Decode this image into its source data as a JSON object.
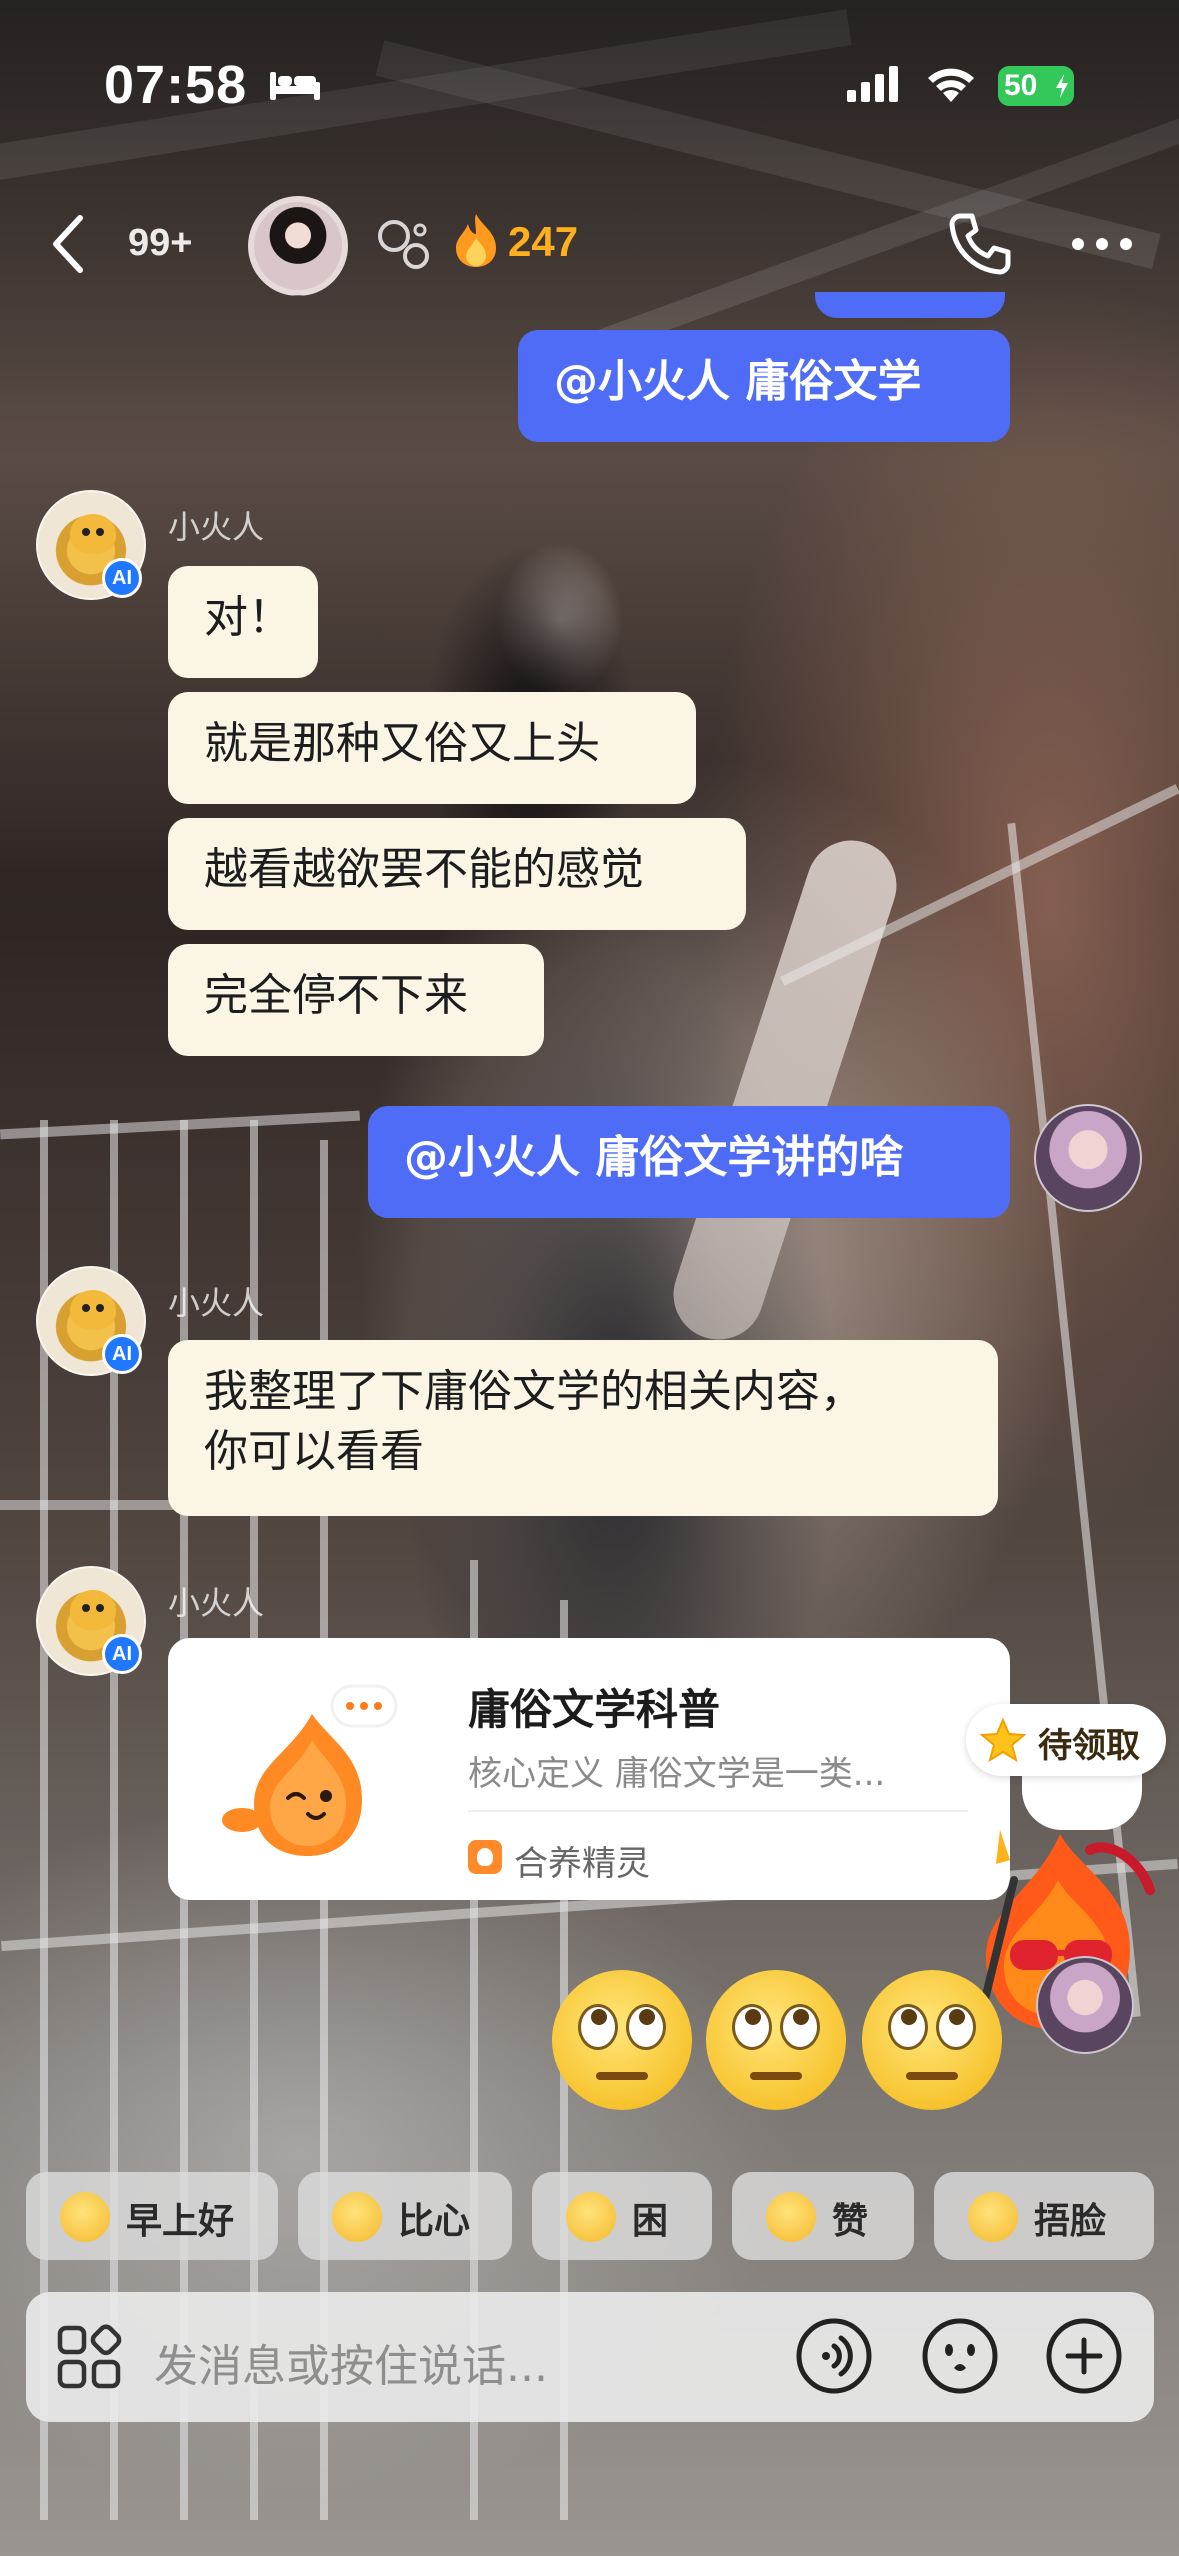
{
  "status_bar": {
    "time": "07:58",
    "battery": "50"
  },
  "header": {
    "unread_count": "99+",
    "streak": "247"
  },
  "messages": {
    "m1": "@小火人 庸俗文学",
    "ai_name": "小火人",
    "m2": "对！",
    "m3": "就是那种又俗又上头",
    "m4": "越看越欲罢不能的感觉",
    "m5": "完全停不下来",
    "m6": "@小火人 庸俗文学讲的啥",
    "m7_line1": "我整理了下庸俗文学的相关内容，",
    "m7_line2": "你可以看看",
    "ai_badge": "AI"
  },
  "card": {
    "title": "庸俗文学科普",
    "description": "核心定义 庸俗文学是一类...",
    "source": "合养精灵"
  },
  "reward": {
    "label": "待领取"
  },
  "quick_replies": [
    {
      "label": "早上好",
      "icon": "sunglasses-sun-emoji"
    },
    {
      "label": "比心",
      "icon": "finger-heart-emoji"
    },
    {
      "label": "困",
      "icon": "sleepy-emoji"
    },
    {
      "label": "赞",
      "icon": "thumbs-up-emoji"
    },
    {
      "label": "捂脸",
      "icon": "facepalm-emoji"
    }
  ],
  "input": {
    "placeholder": "发消息或按住说话..."
  },
  "colors": {
    "outgoing_bubble": "#4f6cf7",
    "incoming_bubble": "#fbf5e6",
    "streak": "#ffb01f",
    "battery": "#34c759"
  },
  "big_emojis": [
    "face-with-rolling-eyes",
    "face-with-rolling-eyes",
    "face-with-rolling-eyes"
  ]
}
